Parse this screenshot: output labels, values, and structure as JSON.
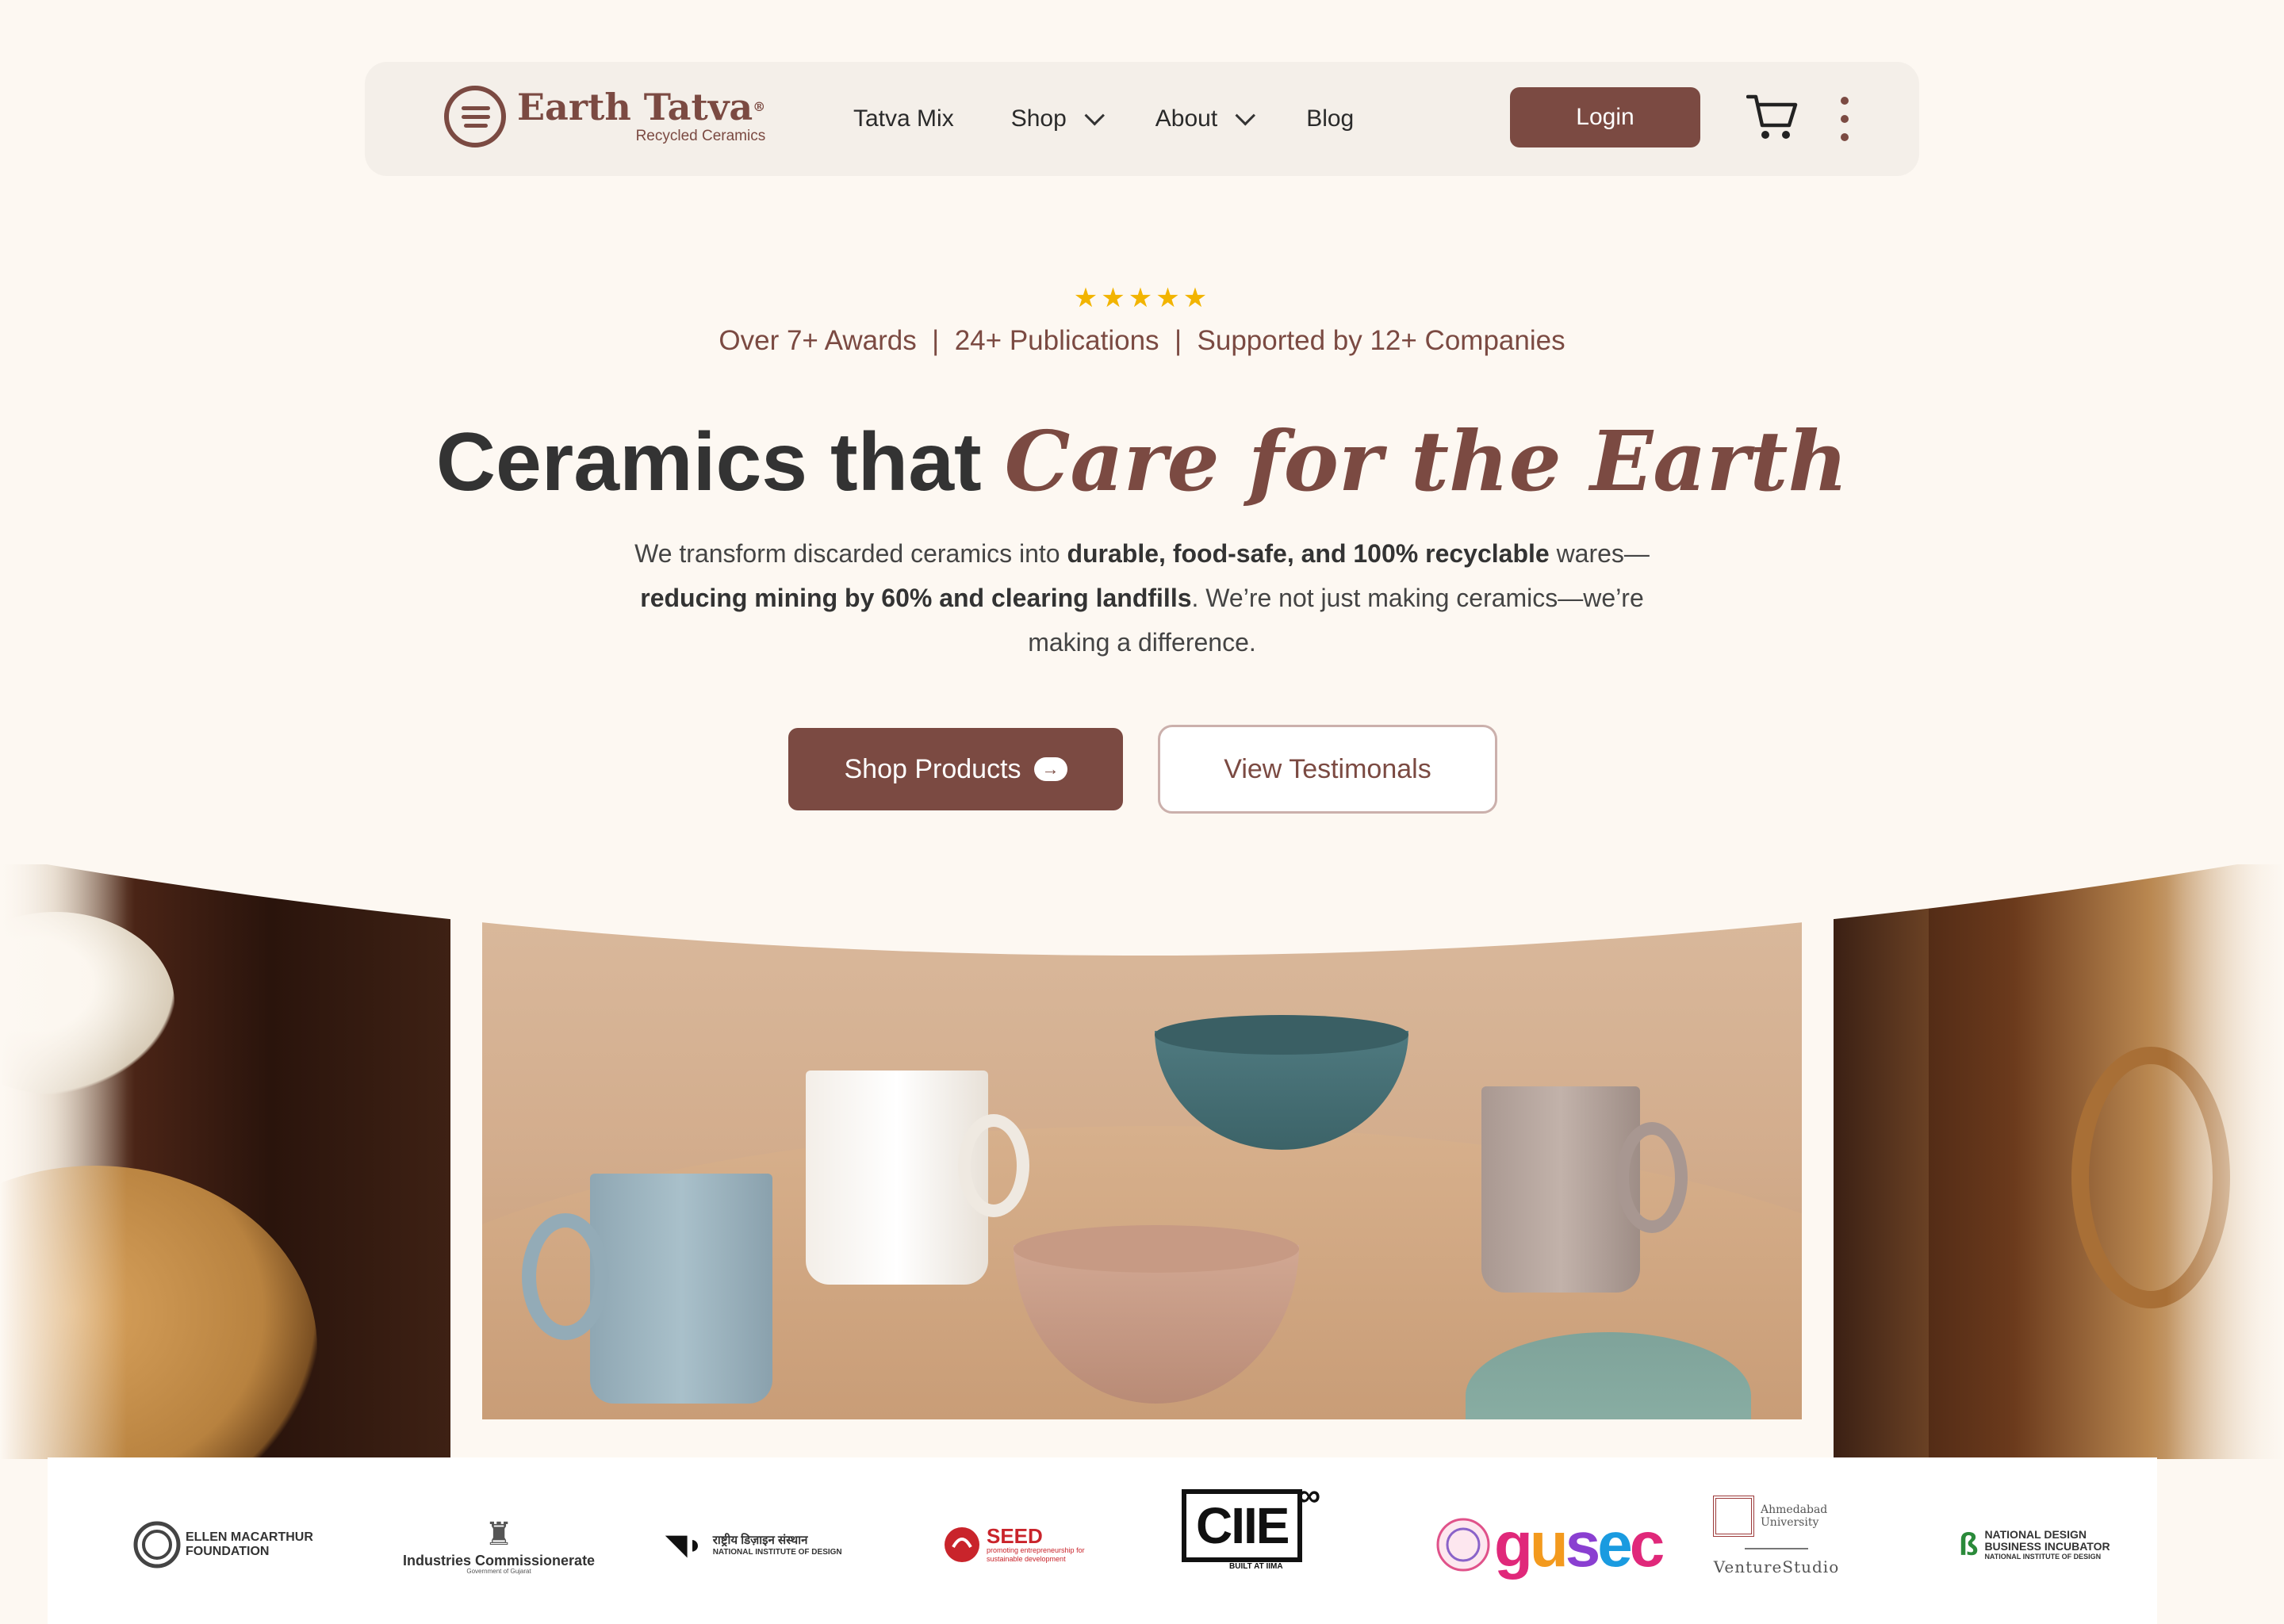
{
  "brand": {
    "name": "Earth Tatva",
    "registered": "®",
    "tagline": "Recycled Ceramics",
    "accent_color": "#7b4a42"
  },
  "nav": {
    "links": [
      {
        "label": "Tatva Mix",
        "dropdown": false
      },
      {
        "label": "Shop",
        "dropdown": true
      },
      {
        "label": "About",
        "dropdown": true
      },
      {
        "label": "Blog",
        "dropdown": false
      }
    ],
    "login_label": "Login",
    "cart_icon": "cart-icon",
    "menu_icon": "kebab-menu-icon"
  },
  "hero": {
    "stars": "★★★★★",
    "rating": 5,
    "stats": "Over 7+ Awards  |  24+ Publications  |  Supported by 12+ Companies",
    "headline_plain": "Ceramics that ",
    "headline_accent": "Care for the Earth",
    "description": {
      "p1": "We transform discarded ceramics into ",
      "b1": "durable, food-safe, and 100% recyclable",
      "p2": " wares—",
      "b2": "reducing mining by 60% and clearing landfills",
      "p3": ". We’re not just making ceramics—we’re making a difference."
    },
    "primary_cta": "Shop Products",
    "secondary_cta": "View Testimonals"
  },
  "partners": [
    {
      "name": "ELLEN MACARTHUR FOUNDATION"
    },
    {
      "name": "Industries Commissionerate",
      "sub": "Government of Gujarat"
    },
    {
      "name": "राष्ट्रीय डिज़ाइन संस्थान",
      "sub": "NATIONAL INSTITUTE OF DESIGN"
    },
    {
      "name": "SEED",
      "sub": "promoting entrepreneurship for sustainable development"
    },
    {
      "name": "CIIE",
      "sub": "BUILT AT IIMA"
    },
    {
      "name": "gusec"
    },
    {
      "name": "Ahmedabad University",
      "sub": "VentureStudio"
    },
    {
      "name": "NATIONAL DESIGN BUSINESS INCUBATOR",
      "sub": "NATIONAL INSTITUTE OF DESIGN"
    }
  ]
}
